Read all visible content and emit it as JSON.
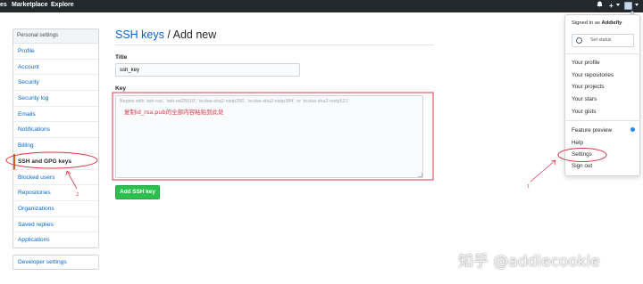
{
  "header": {
    "nav_partial": "es",
    "nav": [
      "Marketplace",
      "Explore"
    ],
    "bell_icon": "bell-icon",
    "plus_icon": "plus-icon"
  },
  "sidebar": {
    "header": "Personal settings",
    "items": [
      {
        "label": "Profile"
      },
      {
        "label": "Account"
      },
      {
        "label": "Security"
      },
      {
        "label": "Security log"
      },
      {
        "label": "Emails"
      },
      {
        "label": "Notifications"
      },
      {
        "label": "Billing"
      },
      {
        "label": "SSH and GPG keys",
        "selected": true
      },
      {
        "label": "Blocked users"
      },
      {
        "label": "Repositories"
      },
      {
        "label": "Organizations"
      },
      {
        "label": "Saved replies"
      },
      {
        "label": "Applications"
      }
    ],
    "developer": "Developer settings"
  },
  "main": {
    "breadcrumb": "SSH keys",
    "separator": " / ",
    "title": "Add new",
    "title_label": "Title",
    "title_value": "ssh_key",
    "key_label": "Key",
    "key_placeholder": "Begins with 'ssh-rsa', 'ssh-ed25519', 'ecdsa-sha2-nistp256', 'ecdsa-sha2-nistp384', or 'ecdsa-sha2-nistp521'",
    "note": "复制id_rsa.pub的全部内容粘贴到此处",
    "add_button": "Add SSH key"
  },
  "dropdown": {
    "signed_prefix": "Signed in as ",
    "username": "Addiefly",
    "set_status": "Set status",
    "items": [
      "Your profile",
      "Your repositories",
      "Your projects",
      "Your stars",
      "Your gists"
    ],
    "items2": [
      "Feature preview",
      "Help",
      "Settings",
      "Sign out"
    ]
  },
  "annotations": {
    "one": "1",
    "two": "2",
    "color": "#d73a49"
  },
  "watermark": "知乎 @addiecookie"
}
